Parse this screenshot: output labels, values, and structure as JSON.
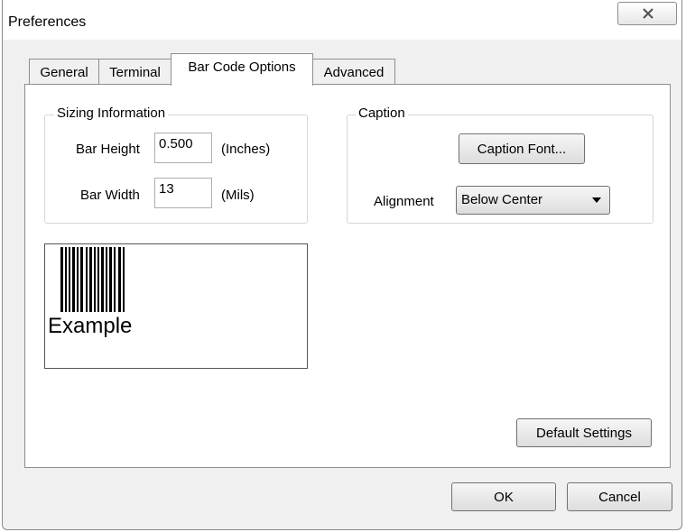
{
  "window": {
    "title": "Preferences"
  },
  "tabs": [
    {
      "label": "General"
    },
    {
      "label": "Terminal"
    },
    {
      "label": "Bar Code Options",
      "active": true
    },
    {
      "label": "Advanced"
    }
  ],
  "sizing": {
    "group_label": "Sizing Information",
    "bar_height_label": "Bar Height",
    "bar_height_value": "0.500",
    "bar_height_unit": "(Inches)",
    "bar_width_label": "Bar Width",
    "bar_width_value": "13",
    "bar_width_unit": "(Mils)"
  },
  "caption": {
    "group_label": "Caption",
    "font_button": "Caption Font...",
    "alignment_label": "Alignment",
    "alignment_value": "Below Center"
  },
  "preview": {
    "caption_text": "Example"
  },
  "buttons": {
    "default_settings": "Default Settings",
    "ok": "OK",
    "cancel": "Cancel"
  },
  "icons": {
    "close": "close-icon",
    "dropdown": "chevron-down-icon",
    "barcode": "barcode-icon"
  }
}
